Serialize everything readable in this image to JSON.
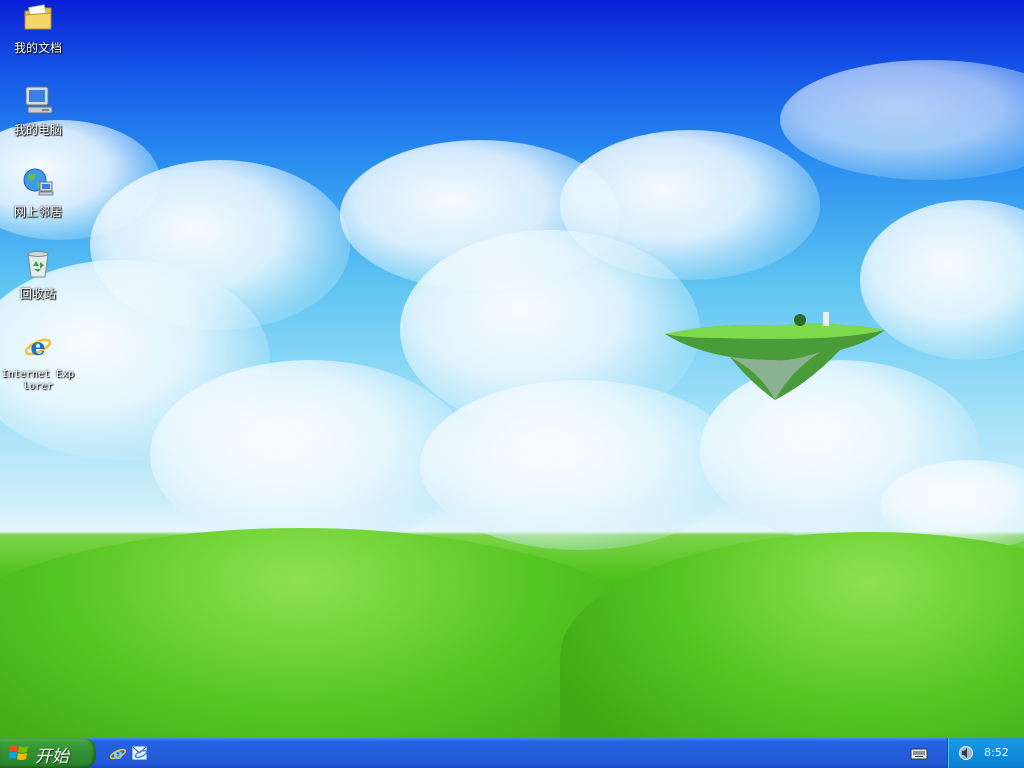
{
  "desktop": {
    "icons": [
      {
        "label": "我的文档",
        "icon": "my-documents-folder-icon"
      },
      {
        "label": "我的电脑",
        "icon": "my-computer-icon"
      },
      {
        "label": "网上邻居",
        "icon": "network-places-icon"
      },
      {
        "label": "回收站",
        "icon": "recycle-bin-icon"
      },
      {
        "label": "Internet Explorer",
        "icon": "internet-explorer-icon"
      }
    ]
  },
  "taskbar": {
    "start_label": "开始",
    "quick_launch": [
      {
        "icon": "internet-explorer-icon"
      },
      {
        "icon": "outlook-express-icon"
      }
    ],
    "tray": {
      "keyboard_icon": "keyboard-icon",
      "volume_icon": "volume-icon",
      "clock": "8:52"
    }
  },
  "colors": {
    "taskbar_blue": "#245edb",
    "start_green": "#318f31",
    "tray_blue": "#0d8ddb"
  }
}
